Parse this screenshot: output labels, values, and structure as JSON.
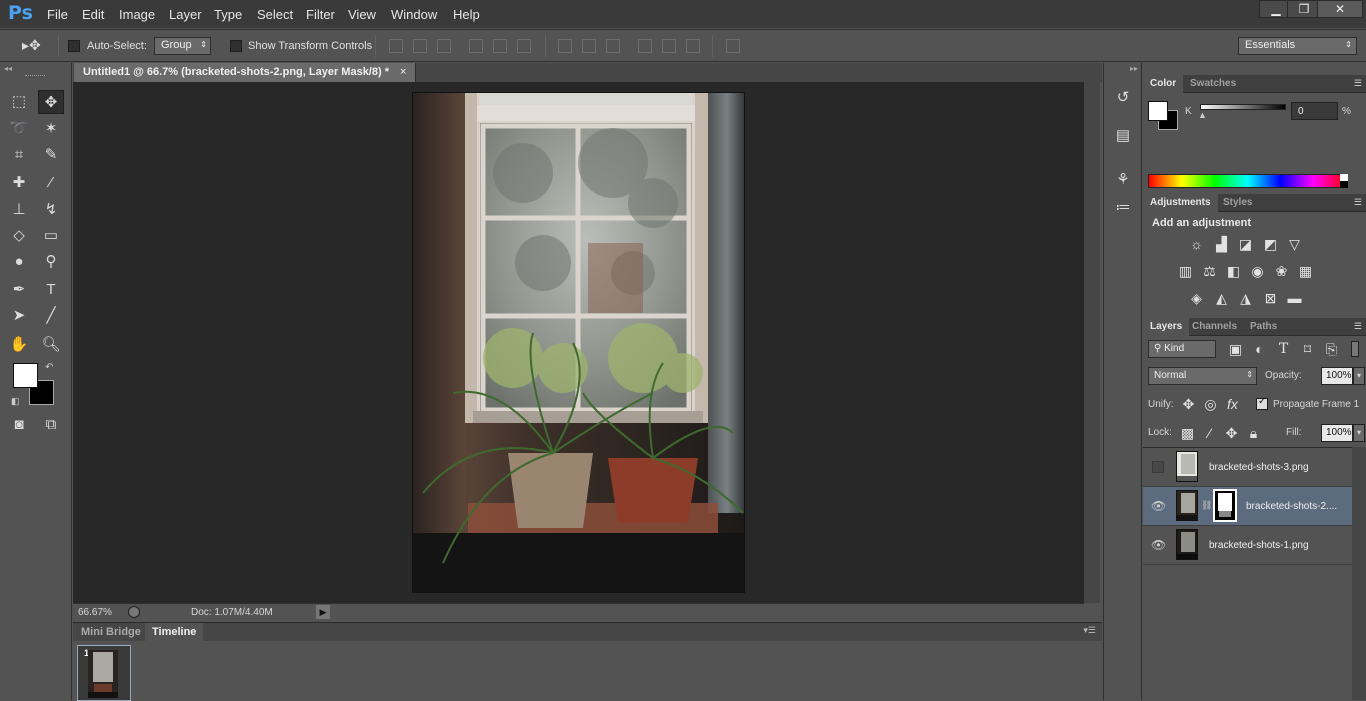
{
  "app": {
    "logo": "Ps"
  },
  "menu": [
    "File",
    "Edit",
    "Image",
    "Layer",
    "Type",
    "Select",
    "Filter",
    "View",
    "Window",
    "Help"
  ],
  "window_controls": {
    "minimize": "▁",
    "restore": "❐",
    "close": "✕"
  },
  "options": {
    "auto_select_label": "Auto-Select:",
    "auto_select_value": "Group",
    "transform_label": "Show Transform Controls",
    "workspace": "Essentials"
  },
  "document": {
    "tab_title": "Untitled1 @ 66.7% (bracketed-shots-2.png, Layer Mask/8) *",
    "close": "×"
  },
  "status": {
    "zoom": "66.67%",
    "doc": "Doc: 1.07M/4.40M"
  },
  "bottom_tabs": [
    "Mini Bridge",
    "Timeline"
  ],
  "timeline": {
    "frame_number": "1"
  },
  "color_panel": {
    "tabs": [
      "Color",
      "Swatches"
    ],
    "channel": "K",
    "value": "0",
    "unit": "%"
  },
  "adjustments_panel": {
    "tabs": [
      "Adjustments",
      "Styles"
    ],
    "heading": "Add an adjustment"
  },
  "layers_panel": {
    "tabs": [
      "Layers",
      "Channels",
      "Paths"
    ],
    "filter": "Kind",
    "blend_mode": "Normal",
    "opacity_label": "Opacity:",
    "opacity": "100%",
    "unify_label": "Unify:",
    "propagate_label": "Propagate Frame 1",
    "lock_label": "Lock:",
    "fill_label": "Fill:",
    "fill": "100%",
    "layers": [
      {
        "name": "bracketed-shots-3.png",
        "visible": false,
        "selected": false,
        "mask": false
      },
      {
        "name": "bracketed-shots-2....",
        "visible": true,
        "selected": true,
        "mask": true
      },
      {
        "name": "bracketed-shots-1.png",
        "visible": true,
        "selected": false,
        "mask": false
      }
    ]
  },
  "colors": {
    "accent": "#4aa2f0",
    "selected_layer": "#5d6b7f",
    "canvas_bg": "#282828"
  }
}
